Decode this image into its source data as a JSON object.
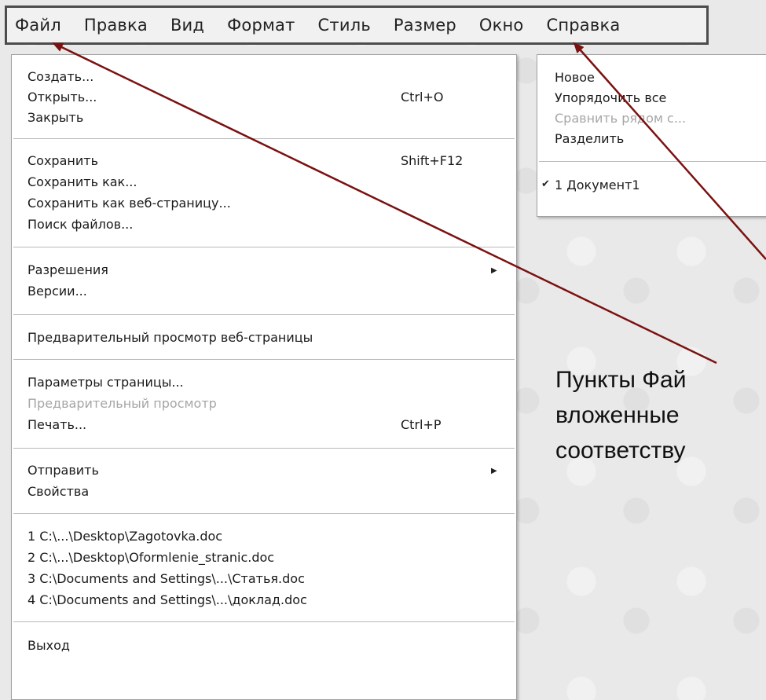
{
  "menubar": {
    "items": [
      "Файл",
      "Правка",
      "Вид",
      "Формат",
      "Стиль",
      "Размер",
      "Окно",
      "Справка"
    ]
  },
  "file_menu": {
    "create": "Создать...",
    "open": "Открыть...",
    "open_shortcut": "Ctrl+O",
    "close": "Закрыть",
    "save": "Сохранить",
    "save_shortcut": "Shift+F12",
    "save_as": "Сохранить как...",
    "save_as_web": "Сохранить как веб-страницу...",
    "find_files": "Поиск файлов...",
    "permissions": "Разрешения",
    "versions": "Версии...",
    "web_preview": "Предварительный просмотр веб-страницы",
    "page_setup": "Параметры страницы...",
    "print_preview": "Предварительный просмотр",
    "print": "Печать...",
    "print_shortcut": "Ctrl+P",
    "send": "Отправить",
    "properties": "Свойства",
    "recent": [
      "1 C:\\...\\Desktop\\Zagotovka.doc",
      "2 C:\\...\\Desktop\\Oformlenie_stranic.doc",
      "3 C:\\Documents and Settings\\...\\Статья.doc",
      "4 C:\\Documents and Settings\\...\\доклад.doc"
    ],
    "exit": "Выход"
  },
  "window_menu": {
    "new": "Новое",
    "arrange_all": "Упорядочить все",
    "compare_side": "Сравнить рядом с...",
    "split": "Разделить",
    "doc1": "1 Документ1"
  },
  "annotation": {
    "line1": "Пункты Фай",
    "line2": "вложенные",
    "line3": "соответству"
  },
  "colors": {
    "arrow": "#7a1212",
    "menubar_border": "#4c4c4c",
    "disabled_text": "#a6a6a6"
  }
}
